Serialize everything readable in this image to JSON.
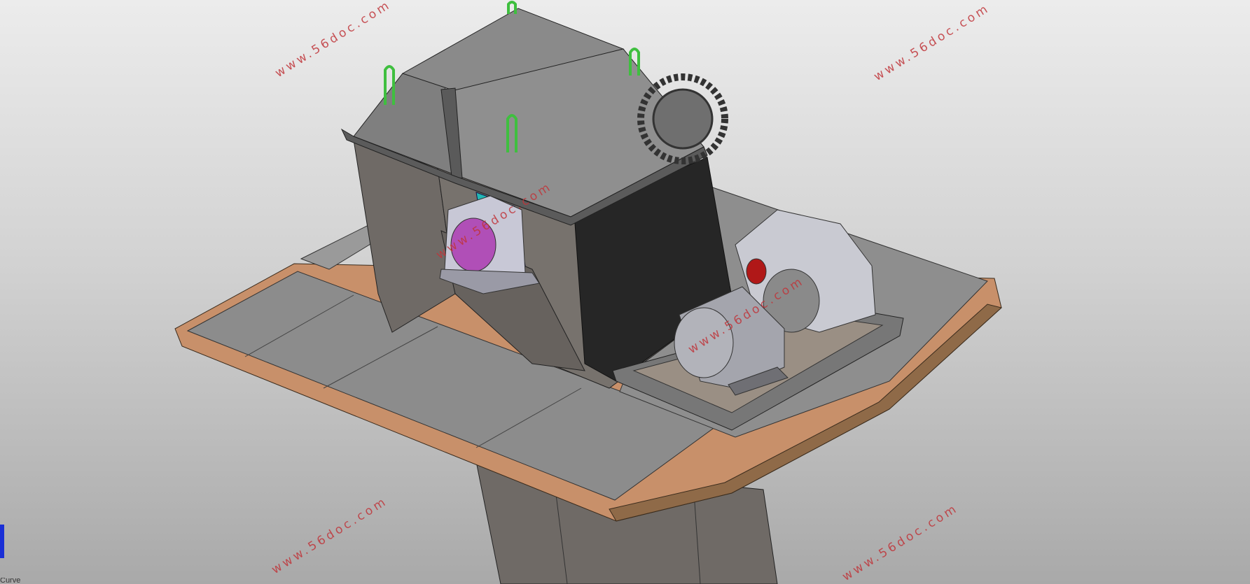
{
  "viewport": {
    "watermark_text": "www.56doc.com",
    "corner_label": "Curve"
  },
  "colors": {
    "background_top": "#ececec",
    "background_bottom": "#a9a9a9",
    "platform_edge": "#c8906a",
    "platform_face": "#8c8c8c",
    "housing": "#6f6a66",
    "housing_top": "#8a8a8a",
    "housing_dark": "#262626",
    "bearing_face": "#b04fb7",
    "bearing_plate": "#23b7b4",
    "lifting_lugs": "#3fbf3f",
    "gearbox_flange": "#b01818",
    "watermark": "#c0353a"
  },
  "icons": [
    "view-triad-icon"
  ]
}
